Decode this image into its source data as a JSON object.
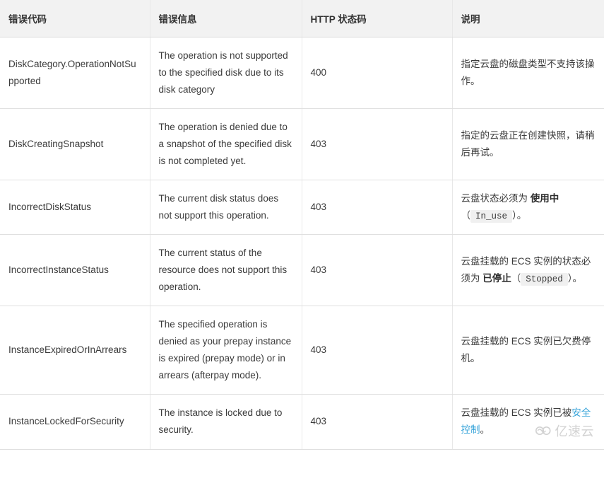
{
  "table": {
    "columns": [
      {
        "key": "code",
        "label": "错误代码"
      },
      {
        "key": "msg",
        "label": "错误信息"
      },
      {
        "key": "status",
        "label": "HTTP 状态码"
      },
      {
        "key": "desc",
        "label": "说明"
      }
    ],
    "rows": [
      {
        "code": "DiskCategory.OperationNotSupported",
        "msg": "The operation is not supported to the specified disk due to its disk category",
        "status": "400",
        "desc_parts": [
          {
            "type": "text",
            "text": "指定云盘的磁盘类型不支持该操作。"
          }
        ]
      },
      {
        "code": "DiskCreatingSnapshot",
        "msg": "The operation is denied due to a snapshot of the specified disk is not completed yet.",
        "status": "403",
        "desc_parts": [
          {
            "type": "text",
            "text": "指定的云盘正在创建快照，请稍后再试。"
          }
        ]
      },
      {
        "code": "IncorrectDiskStatus",
        "msg": "The current disk status does not support this operation.",
        "status": "403",
        "desc_parts": [
          {
            "type": "text",
            "text": "云盘状态必须为 "
          },
          {
            "type": "strong",
            "text": "使用中"
          },
          {
            "type": "text",
            "text": "（"
          },
          {
            "type": "code",
            "text": "In_use"
          },
          {
            "type": "text",
            "text": "）。"
          }
        ]
      },
      {
        "code": "IncorrectInstanceStatus",
        "msg": "The current status of the resource does not support this operation.",
        "status": "403",
        "desc_parts": [
          {
            "type": "text",
            "text": "云盘挂载的 ECS 实例的状态必须为 "
          },
          {
            "type": "strong",
            "text": "已停止"
          },
          {
            "type": "text",
            "text": "（"
          },
          {
            "type": "code",
            "text": "Stopped"
          },
          {
            "type": "text",
            "text": "）。"
          }
        ]
      },
      {
        "code": "InstanceExpiredOrInArrears",
        "msg": "The specified operation is denied as your prepay instance is expired (prepay mode) or in arrears (afterpay mode).",
        "status": "403",
        "desc_parts": [
          {
            "type": "text",
            "text": "云盘挂载的 ECS 实例已欠费停机。"
          }
        ]
      },
      {
        "code": "InstanceLockedForSecurity",
        "msg": "The instance is locked due to security.",
        "status": "403",
        "desc_parts": [
          {
            "type": "text",
            "text": "云盘挂载的 ECS 实例已被"
          },
          {
            "type": "link",
            "text": "安全控制"
          },
          {
            "type": "text",
            "text": "。"
          }
        ]
      }
    ]
  },
  "watermark": {
    "text": "亿速云",
    "icon": "cloud-loop-logo-icon",
    "color": "#8a8a8a"
  },
  "colors": {
    "header_bg": "#f2f2f2",
    "border": "#e0e0e0",
    "link": "#36a3d9",
    "code_bg": "#f0f0f0",
    "text": "#3a3a3a"
  }
}
